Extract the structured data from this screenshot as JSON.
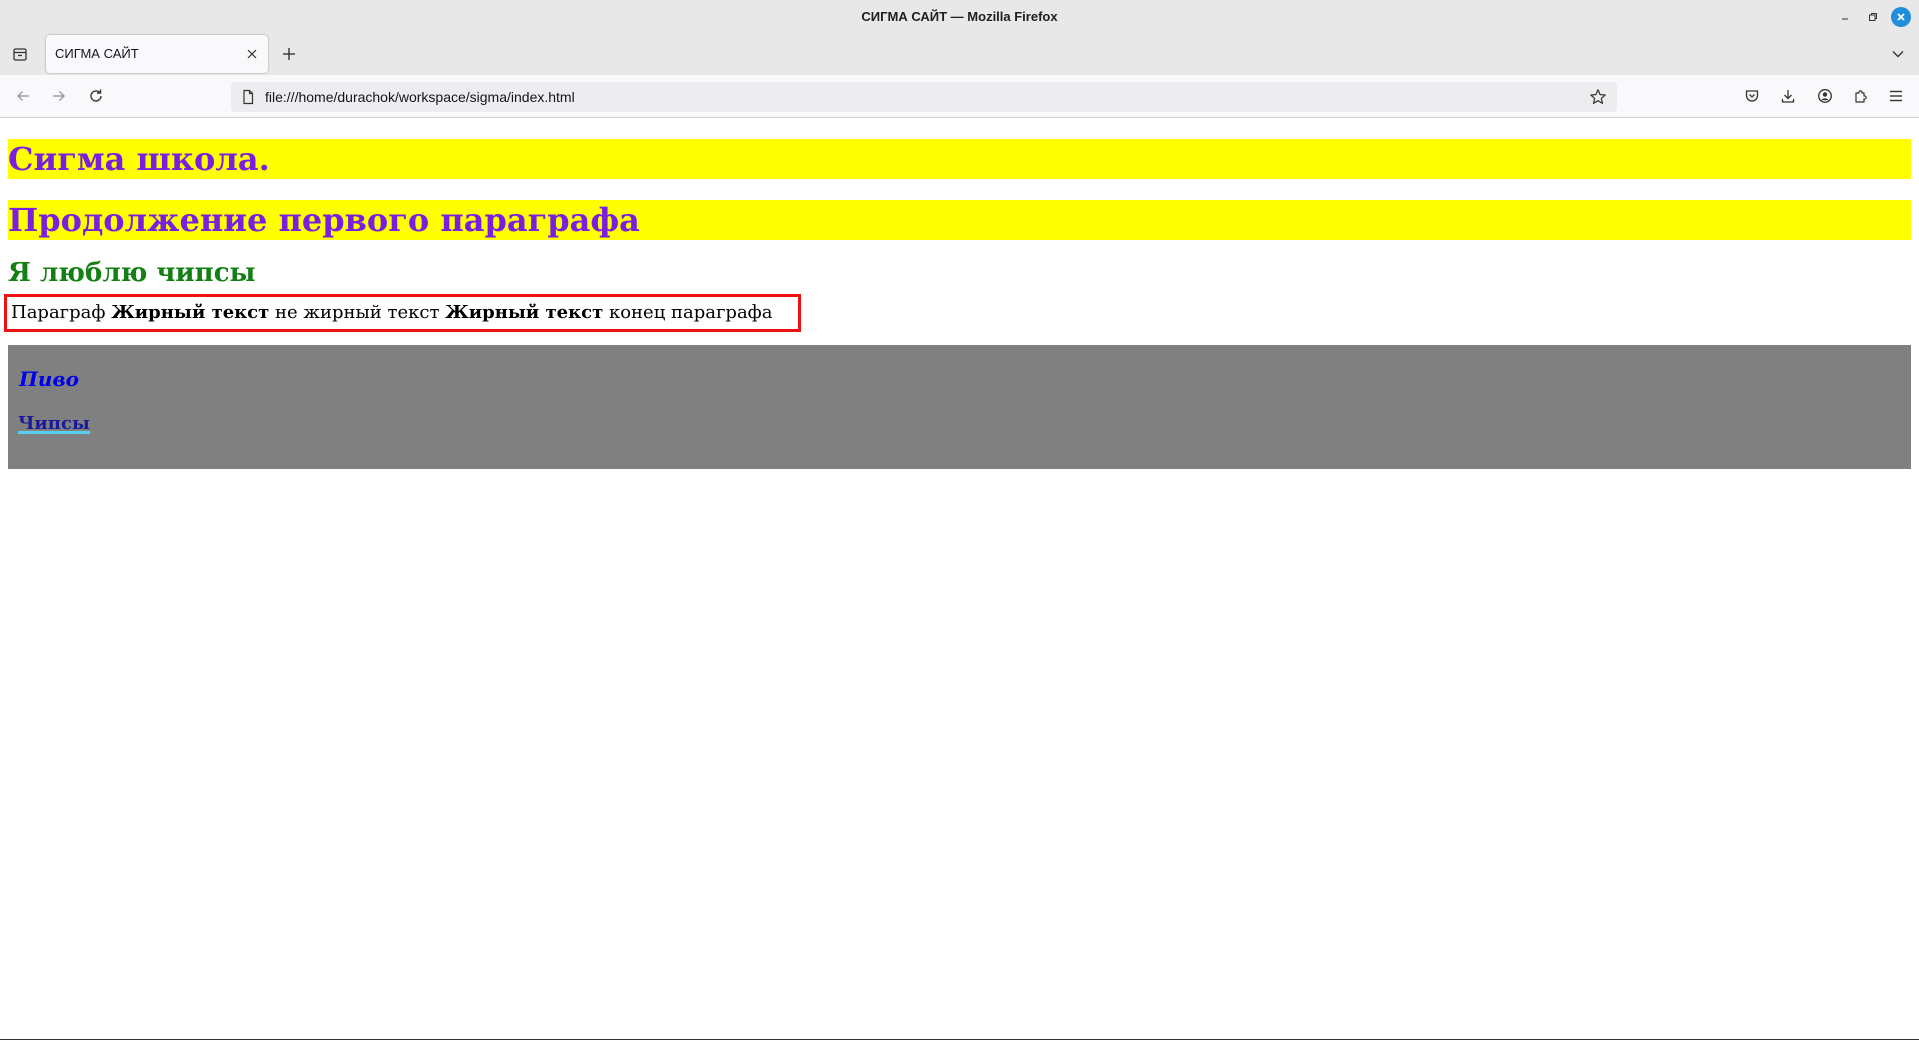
{
  "window": {
    "title": "СИГМА САЙТ — Mozilla Firefox"
  },
  "tabs": [
    {
      "title": "СИГМА САЙТ",
      "active": true
    }
  ],
  "navigation": {
    "url": "file:///home/durachok/workspace/sigma/index.html"
  },
  "icons": {
    "list_all_tabs": "list-all-tabs-icon",
    "tab_close": "close-icon",
    "new_tab": "plus-icon",
    "tabs_menu": "chevron-down-icon",
    "back": "back-arrow-icon",
    "forward": "forward-arrow-icon",
    "reload": "reload-icon",
    "page": "page-icon",
    "bookmark": "star-icon",
    "pocket": "pocket-icon",
    "downloads": "download-icon",
    "account": "account-icon",
    "extensions": "puzzle-icon",
    "menu": "hamburger-menu-icon"
  },
  "page": {
    "heading1": "Сигма школа.",
    "heading2": "Продолжение первого параграфа",
    "heading3": "Я люблю чипсы",
    "paragraph": {
      "part1": "Параграф ",
      "bold1": "Жирный текст",
      "part2": " не жирный текст ",
      "bold2": "Жирный текст",
      "part3": " конец параграфа"
    },
    "gray_block": {
      "italic_text": "Пиво",
      "link_text": "Чипсы"
    }
  },
  "colors": {
    "heading_bg": "#ffff00",
    "heading_text": "#7a1ee0",
    "heading3_text": "#128012",
    "paragraph_border": "#ee1111",
    "gray_block_bg": "#808080",
    "italic_text": "#0000ee",
    "close_button": "#1f8fd9"
  }
}
